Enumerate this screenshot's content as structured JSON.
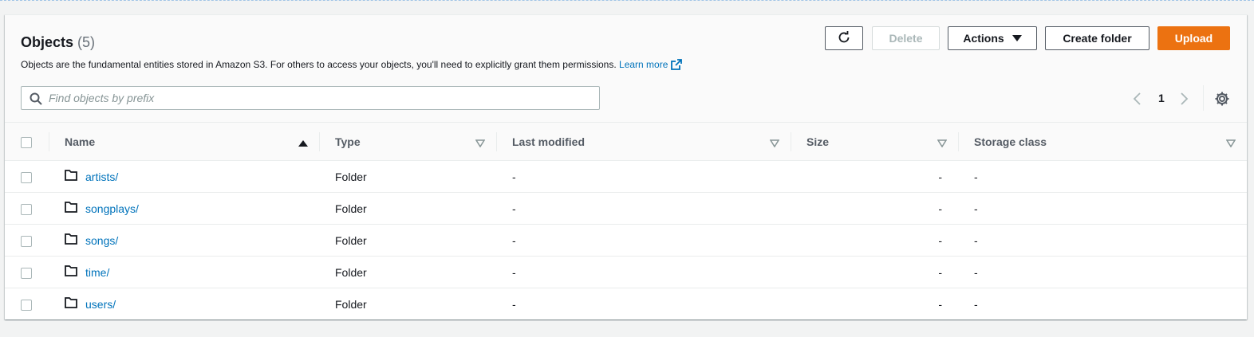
{
  "header": {
    "title": "Objects",
    "count": "(5)",
    "description": "Objects are the fundamental entities stored in Amazon S3. For others to access your objects, you'll need to explicitly grant them permissions.",
    "learn_more": "Learn more"
  },
  "toolbar": {
    "refresh_icon": "refresh-icon",
    "delete_label": "Delete",
    "actions_label": "Actions",
    "create_folder_label": "Create folder",
    "upload_label": "Upload"
  },
  "search": {
    "placeholder": "Find objects by prefix",
    "value": ""
  },
  "pagination": {
    "current_page": "1"
  },
  "table": {
    "columns": [
      "Name",
      "Type",
      "Last modified",
      "Size",
      "Storage class"
    ],
    "sort_column": "Name",
    "rows": [
      {
        "name": "artists/",
        "type": "Folder",
        "last_modified": "-",
        "size": "-",
        "storage_class": "-"
      },
      {
        "name": "songplays/",
        "type": "Folder",
        "last_modified": "-",
        "size": "-",
        "storage_class": "-"
      },
      {
        "name": "songs/",
        "type": "Folder",
        "last_modified": "-",
        "size": "-",
        "storage_class": "-"
      },
      {
        "name": "time/",
        "type": "Folder",
        "last_modified": "-",
        "size": "-",
        "storage_class": "-"
      },
      {
        "name": "users/",
        "type": "Folder",
        "last_modified": "-",
        "size": "-",
        "storage_class": "-"
      }
    ]
  },
  "colors": {
    "accent_link": "#0073bb",
    "upload_orange": "#ec7211",
    "page_bg": "#f2f3f3"
  }
}
